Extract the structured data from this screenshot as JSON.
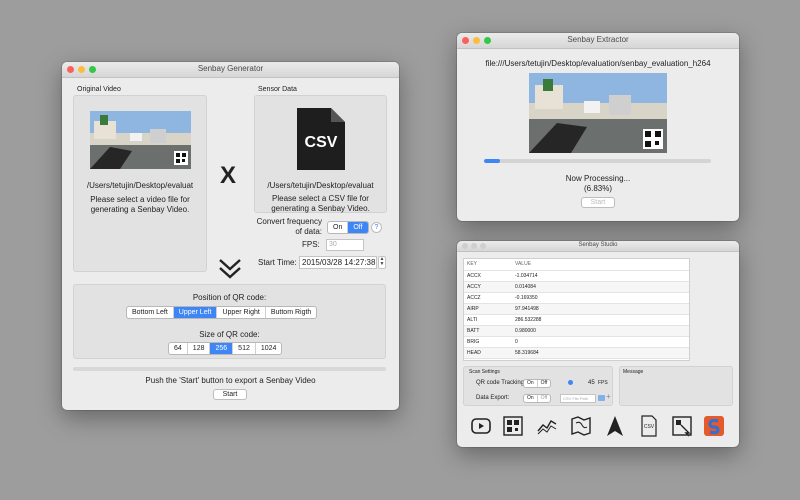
{
  "generator": {
    "title": "Senbay Generator",
    "original_video_label": "Original Video",
    "sensor_data_label": "Sensor Data",
    "video_path": "/Users/tetujin/Desktop/evaluat",
    "video_hint": "Please select a video file for\ngenerating a Senbay Video.",
    "times_symbol": "X",
    "csv_icon_text": "CSV",
    "csv_path": "/Users/tetujin/Desktop/evaluat",
    "csv_hint": "Please select a CSV file for\ngenerating a Senbay Video.",
    "convert_label": "Convert frequency\nof data:",
    "on_label": "On",
    "off_label": "Off",
    "help_label": "?",
    "fps_label": "FPS:",
    "fps_placeholder": "30",
    "start_time_label": "Start Time:",
    "start_time_value": "2015/03/28 14:27:38",
    "qr_position_label": "Position of QR code:",
    "qr_positions": [
      "Bottom Left",
      "Upper Left",
      "Upper Right",
      "Buttom Rigth"
    ],
    "qr_position_selected": "Upper Left",
    "qr_size_label": "Size of QR code:",
    "qr_sizes": [
      "64",
      "128",
      "256",
      "512",
      "1024"
    ],
    "qr_size_selected": "256",
    "push_hint": "Push the 'Start' button to export a Senbay Video",
    "start_button": "Start"
  },
  "extractor": {
    "title": "Senbay Extractor",
    "file_url": "file:///Users/tetujin/Desktop/evaluation/senbay_evaluation_h264",
    "progress": 0.0683,
    "status": "Now Processing...",
    "percent": "(6.83%)",
    "start_button": "Start"
  },
  "studio": {
    "title": "Senbay Studio",
    "col_key": "KEY",
    "col_value": "VALUE",
    "rows": [
      {
        "key": "ACCX",
        "value": "-1.034714"
      },
      {
        "key": "ACCY",
        "value": "0.014084"
      },
      {
        "key": "ACCZ",
        "value": "-0.169350"
      },
      {
        "key": "AIRP",
        "value": "97.941498"
      },
      {
        "key": "ALTI",
        "value": "286.532288"
      },
      {
        "key": "BATT",
        "value": "0.980000"
      },
      {
        "key": "BRIG",
        "value": "0"
      },
      {
        "key": "HEAD",
        "value": "58.319684"
      }
    ],
    "scan_settings_label": "Scan Settings",
    "message_label": "Message",
    "qr_tracking_label": "QR code Tracking:",
    "on_label": "On",
    "off_label": "Off",
    "fps_value": "45",
    "fps_unit": "FPS",
    "data_export_label": "Data Export:",
    "csv_path_placeholder": "CSV File Path",
    "add_symbol": "+",
    "toolbar_icons": [
      "play-icon",
      "qr-code-icon",
      "line-chart-icon",
      "map-icon",
      "compass-arrow-icon",
      "csv-file-icon",
      "qr-scan-icon",
      "senbay-logo-icon"
    ],
    "csv_icon_text": "CSV"
  },
  "colors": {
    "accent": "#3e86f5",
    "desktop": "#9d9d9d",
    "window": "#ececec"
  }
}
